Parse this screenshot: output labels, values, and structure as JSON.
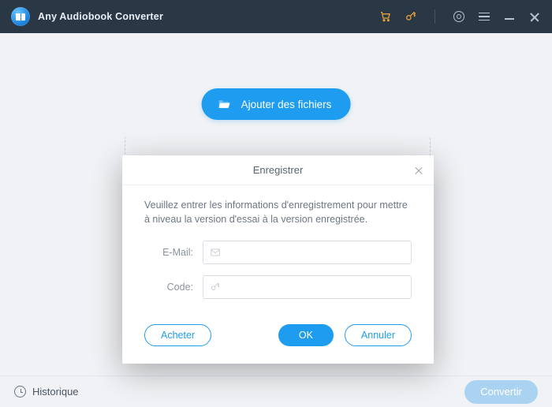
{
  "header": {
    "title": "Any Audiobook Converter"
  },
  "main": {
    "add_files_label": "Ajouter des fichiers"
  },
  "footer": {
    "history_label": "Historique",
    "convert_label": "Convertir"
  },
  "modal": {
    "title": "Enregistrer",
    "intro": "Veuillez entrer les informations d'enregistrement pour mettre à niveau la version d'essai à la version enregistrée.",
    "email_label": "E-Mail:",
    "code_label": "Code:",
    "email_value": "",
    "code_value": "",
    "buy_label": "Acheter",
    "ok_label": "OK",
    "cancel_label": "Annuler"
  },
  "colors": {
    "accent": "#1e9cf0",
    "titlebar": "#2a3744",
    "store_icon": "#e6a23c"
  }
}
